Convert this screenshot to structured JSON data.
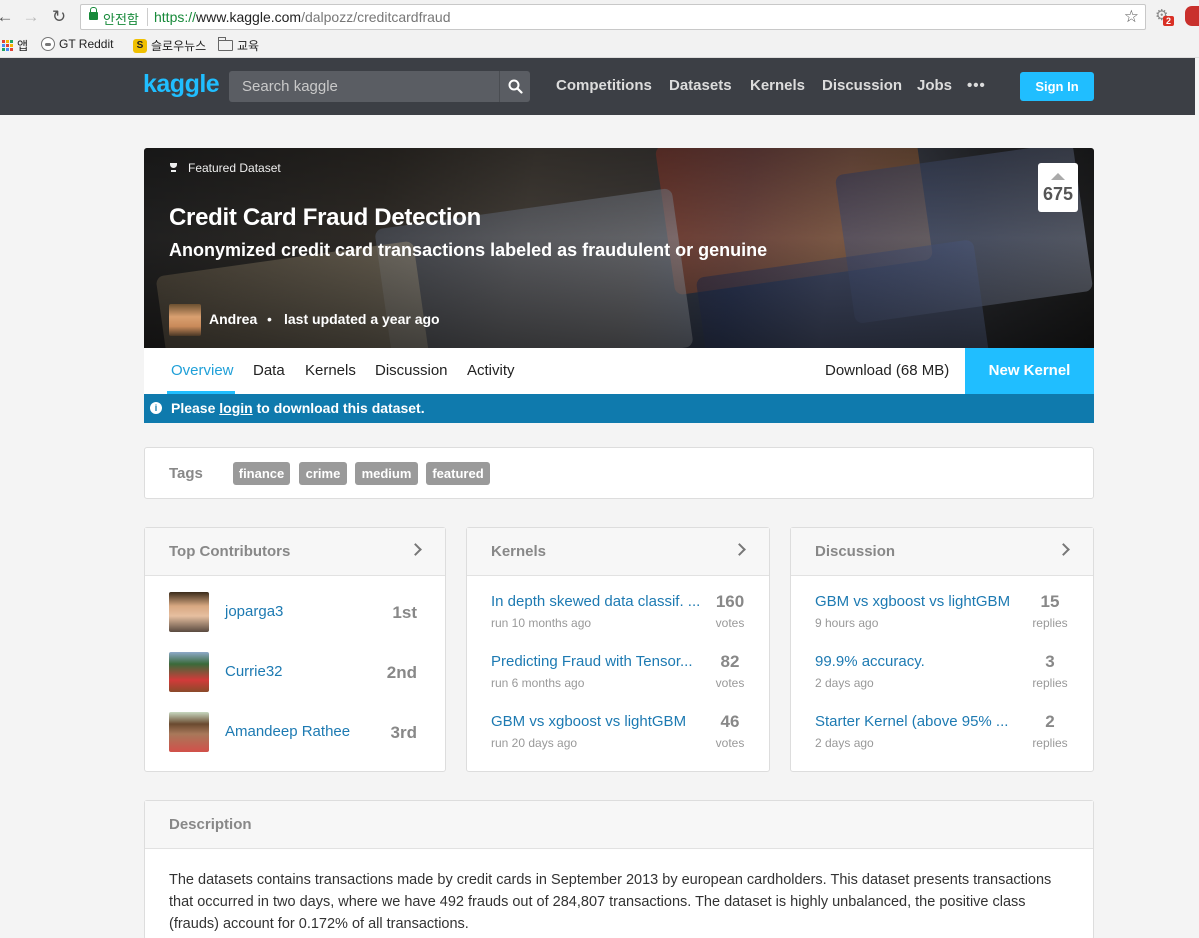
{
  "browser": {
    "secure_label": "안전함",
    "url_scheme": "https://",
    "url_host": "www.kaggle.com",
    "url_path": "/dalpozz/creditcardfraud",
    "badge_count": "2",
    "bookmarks": [
      {
        "label": "앱",
        "icon": "apps-grid-icon"
      },
      {
        "label": "GT Reddit",
        "icon": "reddit-icon"
      },
      {
        "label": "슬로우뉴스",
        "icon": "s-icon"
      },
      {
        "label": "교육",
        "icon": "folder-icon"
      }
    ]
  },
  "header": {
    "logo": "kaggle",
    "search_placeholder": "Search kaggle",
    "nav": [
      "Competitions",
      "Datasets",
      "Kernels",
      "Discussion",
      "Jobs"
    ],
    "more": "•••",
    "sign_in": "Sign In",
    "accent_color": "#20beff"
  },
  "hero": {
    "featured_label": "Featured Dataset",
    "title": "Credit Card Fraud Detection",
    "subtitle": "Anonymized credit card transactions labeled as fraudulent or genuine",
    "author": "Andrea",
    "separator": "•",
    "updated": "last updated a year ago",
    "votes": "675"
  },
  "tabs": {
    "items": [
      "Overview",
      "Data",
      "Kernels",
      "Discussion",
      "Activity"
    ],
    "active": "Overview",
    "download": "Download (68 MB)",
    "new_kernel": "New Kernel"
  },
  "notice": {
    "prefix": "Please ",
    "link": "login",
    "suffix": " to download this dataset."
  },
  "tags": {
    "label": "Tags",
    "items": [
      "finance",
      "crime",
      "medium",
      "featured"
    ]
  },
  "contributors": {
    "title": "Top Contributors",
    "items": [
      {
        "name": "joparga3",
        "rank": "1st"
      },
      {
        "name": "Currie32",
        "rank": "2nd"
      },
      {
        "name": "Amandeep Rathee",
        "rank": "3rd"
      }
    ]
  },
  "kernels": {
    "title": "Kernels",
    "items": [
      {
        "title": "In depth skewed data classif. ...",
        "meta": "run 10 months ago",
        "count": "160",
        "unit": "votes"
      },
      {
        "title": "Predicting Fraud with Tensor...",
        "meta": "run 6 months ago",
        "count": "82",
        "unit": "votes"
      },
      {
        "title": "GBM vs xgboost vs lightGBM",
        "meta": "run 20 days ago",
        "count": "46",
        "unit": "votes"
      }
    ]
  },
  "discussion": {
    "title": "Discussion",
    "items": [
      {
        "title": "GBM vs xgboost vs lightGBM",
        "meta": "9 hours ago",
        "count": "15",
        "unit": "replies"
      },
      {
        "title": "99.9% accuracy.",
        "meta": "2 days ago",
        "count": "3",
        "unit": "replies"
      },
      {
        "title": "Starter Kernel (above 95% ...",
        "meta": "2 days ago",
        "count": "2",
        "unit": "replies"
      }
    ]
  },
  "description": {
    "title": "Description",
    "text": "The datasets contains transactions made by credit cards in September 2013 by european cardholders. This dataset presents transactions that occurred in two days, where we have 492 frauds out of 284,807 transactions. The dataset is highly unbalanced, the positive class (frauds) account for 0.172% of all transactions."
  }
}
